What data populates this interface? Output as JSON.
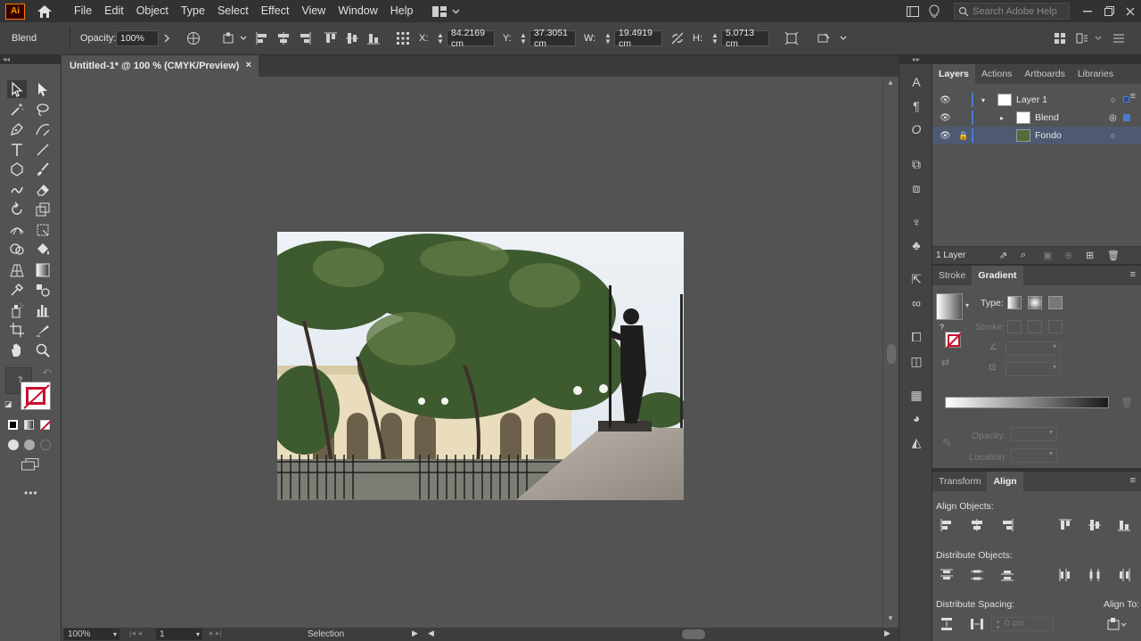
{
  "app": {
    "logo": "Ai"
  },
  "menu": {
    "items": [
      "File",
      "Edit",
      "Object",
      "Type",
      "Select",
      "Effect",
      "View",
      "Window",
      "Help"
    ]
  },
  "search": {
    "placeholder": "Search Adobe Help"
  },
  "control_bar": {
    "selection_label": "Blend",
    "opacity_label": "Opacity:",
    "opacity_value": "100%",
    "x_label": "X:",
    "x_value": "84.2169 cm",
    "y_label": "Y:",
    "y_value": "37.3051 cm",
    "w_label": "W:",
    "w_value": "19.4919 cm",
    "h_label": "H:",
    "h_value": "5.0713 cm"
  },
  "document": {
    "tab_title": "Untitled-1* @ 100 % (CMYK/Preview)",
    "close_glyph": "×"
  },
  "status_bar": {
    "zoom": "100%",
    "artboard_number": "1",
    "tool_name": "Selection"
  },
  "layers_panel": {
    "tabs": [
      "Layers",
      "Actions",
      "Artboards",
      "Libraries"
    ],
    "layers": [
      {
        "name": "Layer 1"
      },
      {
        "name": "Blend"
      },
      {
        "name": "Fondo"
      }
    ],
    "layer_count": "1 Layer"
  },
  "gradient_panel": {
    "tabs": [
      "Stroke",
      "Gradient"
    ],
    "type_label": "Type:",
    "stroke_label": "Stroke:",
    "opacity_label": "Opacity:",
    "location_label": "Location:"
  },
  "align_panel": {
    "tabs": [
      "Transform",
      "Align"
    ],
    "align_objects_label": "Align Objects:",
    "distribute_objects_label": "Distribute Objects:",
    "distribute_spacing_label": "Distribute Spacing:",
    "align_to_label": "Align To:",
    "spacing_value": "0 cm"
  },
  "colors": {
    "menubar": "#323232",
    "controlbar": "#434343",
    "canvas": "#535353",
    "selection_blue": "#4a6a9a",
    "logo_orange": "#ff7c00"
  }
}
